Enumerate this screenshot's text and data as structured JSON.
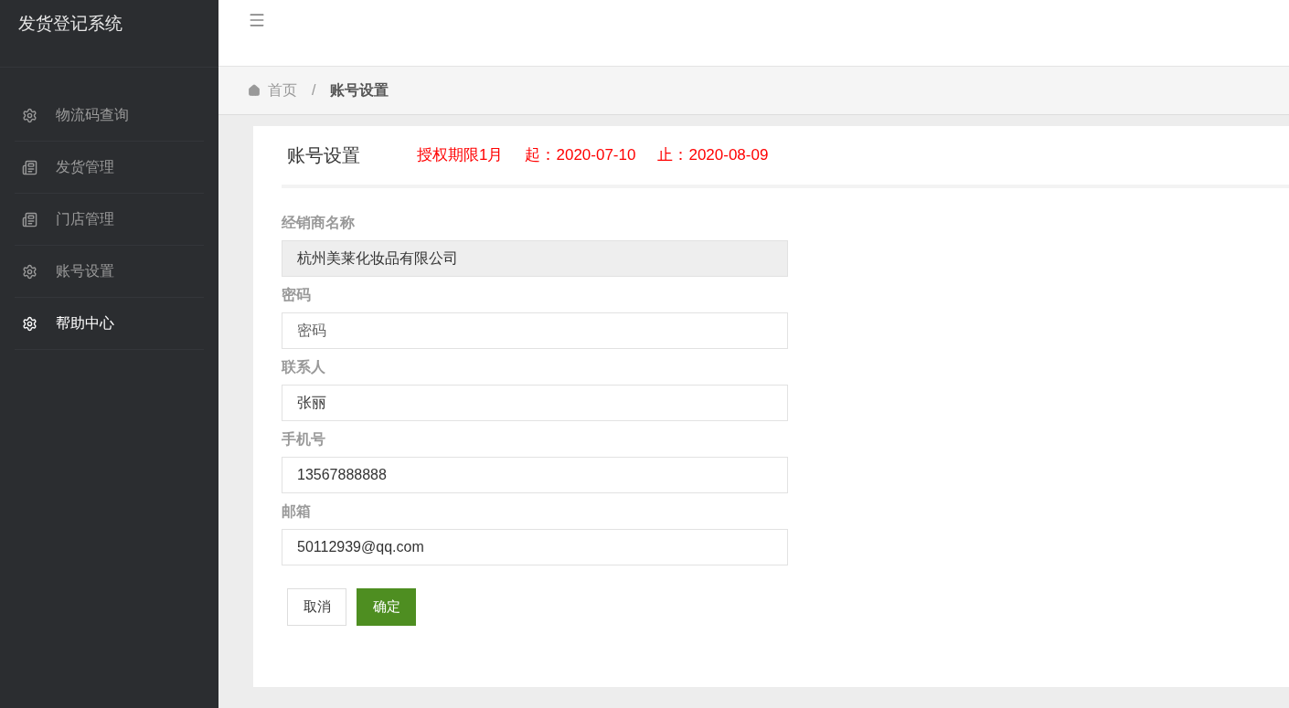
{
  "sidebar": {
    "title": "发货登记系统",
    "items": [
      {
        "label": "物流码查询",
        "kind": "gear",
        "selected": false
      },
      {
        "label": "发货管理",
        "kind": "list",
        "selected": false
      },
      {
        "label": "门店管理",
        "kind": "list",
        "selected": false
      },
      {
        "label": "账号设置",
        "kind": "gear",
        "selected": false
      },
      {
        "label": "帮助中心",
        "kind": "gear",
        "selected": true
      }
    ]
  },
  "breadcrumb": {
    "home": "首页",
    "separator": "/",
    "current": "账号设置"
  },
  "card": {
    "title": "账号设置",
    "license": [
      "授权期限1月",
      "起：2020-07-10",
      "止：2020-08-09"
    ],
    "fields": [
      {
        "label": "经销商名称",
        "kind": "readonly",
        "value": "杭州美莱化妆品有限公司"
      },
      {
        "label": "密码",
        "kind": "input",
        "placeholder": "密码"
      },
      {
        "label": "联系人",
        "kind": "input",
        "value": "张丽"
      },
      {
        "label": "手机号",
        "kind": "input",
        "value": "13567888888"
      },
      {
        "label": "邮箱",
        "kind": "input",
        "value": "50112939@qq.com"
      }
    ],
    "buttons": [
      {
        "label": "取消",
        "kind": "default"
      },
      {
        "label": "确定",
        "kind": "primary"
      }
    ]
  }
}
